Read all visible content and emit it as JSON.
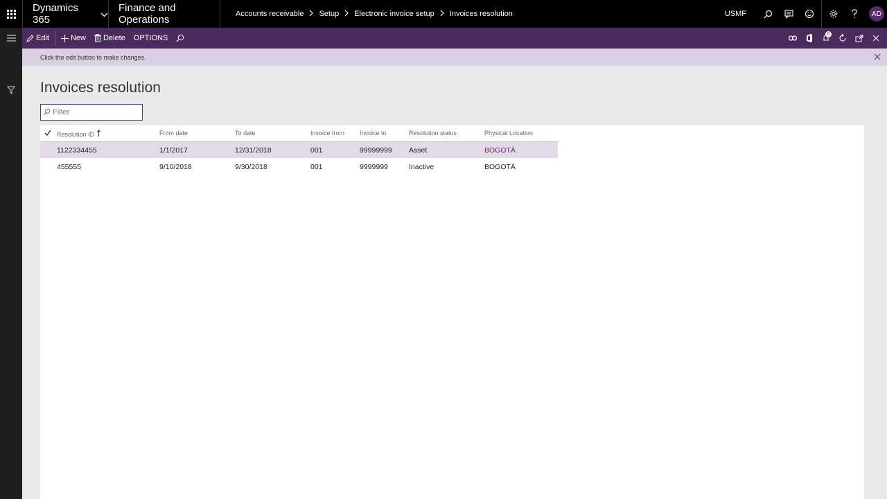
{
  "topbar": {
    "brand": "Dynamics 365",
    "app_name": "Finance and Operations",
    "breadcrumb": [
      "Accounts receivable",
      "Setup",
      "Electronic invoice setup",
      "Invoices resolution"
    ],
    "company": "USMF",
    "user_initials": "AD"
  },
  "actions": {
    "edit": "Edit",
    "new": "New",
    "delete": "Delete",
    "options": "OPTIONS",
    "notification_count": "0"
  },
  "message": "Click the edit button to make changes.",
  "page": {
    "title": "Invoices resolution",
    "filter_placeholder": "Filter"
  },
  "grid": {
    "columns": [
      "Resolution ID",
      "From date",
      "To date",
      "Invoice from",
      "Invoice to",
      "Resolution status",
      "Physical Location"
    ],
    "rows": [
      [
        "1122334455",
        "1/1/2017",
        "12/31/2018",
        "001",
        "99999999",
        "Asset",
        "BOGOTÁ"
      ],
      [
        "455555",
        "9/10/2018",
        "9/30/2018",
        "001",
        "9999999",
        "Inactive",
        "BOGOTÁ"
      ]
    ]
  },
  "colors": {
    "topbar": "#000000",
    "action_pane": "#4b2a5e",
    "message_bar": "#d9cfe0",
    "selected_row": "#e2dbe7",
    "accent": "#5b2a6e"
  }
}
